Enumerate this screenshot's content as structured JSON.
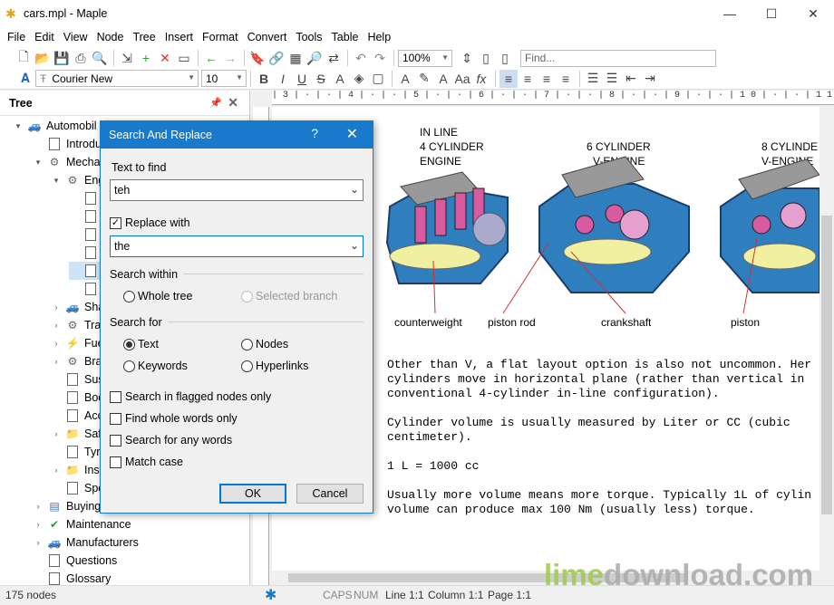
{
  "window": {
    "title": "cars.mpl - Maple"
  },
  "menu": [
    "File",
    "Edit",
    "View",
    "Node",
    "Tree",
    "Insert",
    "Format",
    "Convert",
    "Tools",
    "Table",
    "Help"
  ],
  "toolbar": {
    "zoom": "100%",
    "find_placeholder": "Find...",
    "font": "Courier New",
    "size": "10"
  },
  "tree": {
    "title": "Tree",
    "items": [
      {
        "label": "Automobil",
        "icon": "car-icon"
      },
      {
        "label": "Introdu",
        "icon": "document-icon"
      },
      {
        "label": "Mecha",
        "icon": "gear-icon"
      },
      {
        "label": "Eng",
        "icon": "gear-icon"
      },
      {
        "label": "",
        "icon": "document-icon"
      },
      {
        "label": "",
        "icon": "document-icon"
      },
      {
        "label": "",
        "icon": "document-icon"
      },
      {
        "label": "",
        "icon": "document-icon"
      },
      {
        "label": "",
        "icon": "document-icon"
      },
      {
        "label": "",
        "icon": "document-icon"
      },
      {
        "label": "Sha",
        "icon": "car-icon"
      },
      {
        "label": "Tra",
        "icon": "gear-icon"
      },
      {
        "label": "Fue",
        "icon": "lightning-icon"
      },
      {
        "label": "Bra",
        "icon": "gear-icon"
      },
      {
        "label": "Sus",
        "icon": "document-icon"
      },
      {
        "label": "Boo",
        "icon": "document-icon"
      },
      {
        "label": "Acc",
        "icon": "document-icon"
      },
      {
        "label": "Saf",
        "icon": "folder-icon"
      },
      {
        "label": "Tyr",
        "icon": "document-icon"
      },
      {
        "label": "Inst",
        "icon": "folder-icon"
      },
      {
        "label": "Spe",
        "icon": "document-icon"
      },
      {
        "label": "Buying",
        "icon": "building-icon"
      },
      {
        "label": "Maintenance",
        "icon": "checkmark-icon"
      },
      {
        "label": "Manufacturers",
        "icon": "car-icon"
      },
      {
        "label": "Questions",
        "icon": "document-icon"
      },
      {
        "label": "Glossary",
        "icon": "document-icon"
      }
    ]
  },
  "editor": {
    "figure_labels": [
      "IN LINE",
      "4 CYLINDER",
      "ENGINE",
      "6 CYLINDER",
      "V-ENGINE",
      "8 CYLINDE",
      "V-ENGINE",
      "counterweight",
      "piston rod",
      "crankshaft",
      "piston"
    ],
    "lines": [
      "Other than V, a flat layout option is also not uncommon. Her",
      "cylinders move in horizontal plane (rather than vertical in",
      "conventional 4-cylinder in-line configuration).",
      "",
      "Cylinder volume is usually measured by Liter or CC (cubic",
      "centimeter).",
      "",
      "1 L = 1000 cc",
      "",
      "Usually more volume means more torque. Typically 1L of cylin",
      "volume can produce max 100 Nm (usually less) torque."
    ]
  },
  "dialog": {
    "title": "Search And Replace",
    "help": "?",
    "find_label": "Text to find",
    "find_value": "teh",
    "replace_label": "Replace with",
    "replace_value": "the",
    "within_label": "Search within",
    "whole_tree": "Whole tree",
    "selected_branch": "Selected branch",
    "search_for_label": "Search for",
    "text_opt": "Text",
    "nodes_opt": "Nodes",
    "keywords_opt": "Keywords",
    "hyperlinks_opt": "Hyperlinks",
    "flagged": "Search in flagged nodes only",
    "whole_words": "Find whole words only",
    "any_words": "Search for any words",
    "match_case": "Match case",
    "ok": "OK",
    "cancel": "Cancel"
  },
  "status": {
    "nodes": "175 nodes",
    "caps": "CAPS",
    "num": "NUM",
    "line": "Line 1:1",
    "column": "Column 1:1",
    "page": "Page 1:1"
  },
  "watermark": {
    "part1": "lime",
    "part2": "download.com"
  }
}
